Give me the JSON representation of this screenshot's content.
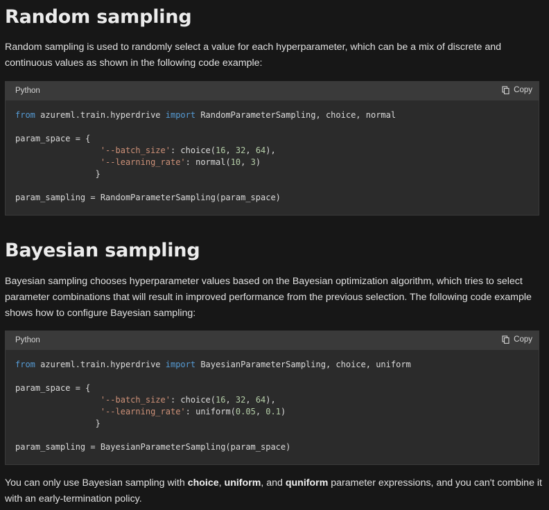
{
  "section1": {
    "heading": "Random sampling",
    "paragraph": "Random sampling is used to randomly select a value for each hyperparameter, which can be a mix of discrete and continuous values as shown in the following code example:",
    "code": {
      "language": "Python",
      "copy_label": "Copy",
      "line1": {
        "kw1": "from",
        "mod": " azureml.train.hyperdrive ",
        "kw2": "import",
        "rest": " RandomParameterSampling, choice, normal"
      },
      "line2": "param_space = {",
      "line3": {
        "indent": "                 ",
        "key": "'--batch_size'",
        "a": ": choice(",
        "n1": "16",
        "c1": ", ",
        "n2": "32",
        "c2": ", ",
        "n3": "64",
        "end": "),"
      },
      "line4": {
        "indent": "                 ",
        "key": "'--learning_rate'",
        "a": ": normal(",
        "n1": "10",
        "c1": ", ",
        "n2": "3",
        "end": ")"
      },
      "line5": "                }",
      "line6": "param_sampling = RandomParameterSampling(param_space)"
    }
  },
  "section2": {
    "heading": "Bayesian sampling",
    "paragraph": "Bayesian sampling chooses hyperparameter values based on the Bayesian optimization algorithm, which tries to select parameter combinations that will result in improved performance from the previous selection. The following code example shows how to configure Bayesian sampling:",
    "code": {
      "language": "Python",
      "copy_label": "Copy",
      "line1": {
        "kw1": "from",
        "mod": " azureml.train.hyperdrive ",
        "kw2": "import",
        "rest": " BayesianParameterSampling, choice, uniform"
      },
      "line2": "param_space = {",
      "line3": {
        "indent": "                 ",
        "key": "'--batch_size'",
        "a": ": choice(",
        "n1": "16",
        "c1": ", ",
        "n2": "32",
        "c2": ", ",
        "n3": "64",
        "end": "),"
      },
      "line4": {
        "indent": "                 ",
        "key": "'--learning_rate'",
        "a": ": uniform(",
        "n1": "0.05",
        "c1": ", ",
        "n2": "0.1",
        "end": ")"
      },
      "line5": "                }",
      "line6": "param_sampling = BayesianParameterSampling(param_space)"
    }
  },
  "footer": {
    "t1": "You can only use Bayesian sampling with ",
    "b1": "choice",
    "t2": ", ",
    "b2": "uniform",
    "t3": ", and ",
    "b3": "quniform",
    "t4": " parameter expressions, and you can't combine it with an early-termination policy."
  },
  "colors": {
    "background": "#171717",
    "code_background": "#2b2b2b",
    "code_header": "#3a3a3a",
    "keyword": "#569cd6",
    "string": "#ce9178",
    "number": "#b5cea8"
  },
  "icons": {
    "copy": "copy-icon"
  }
}
